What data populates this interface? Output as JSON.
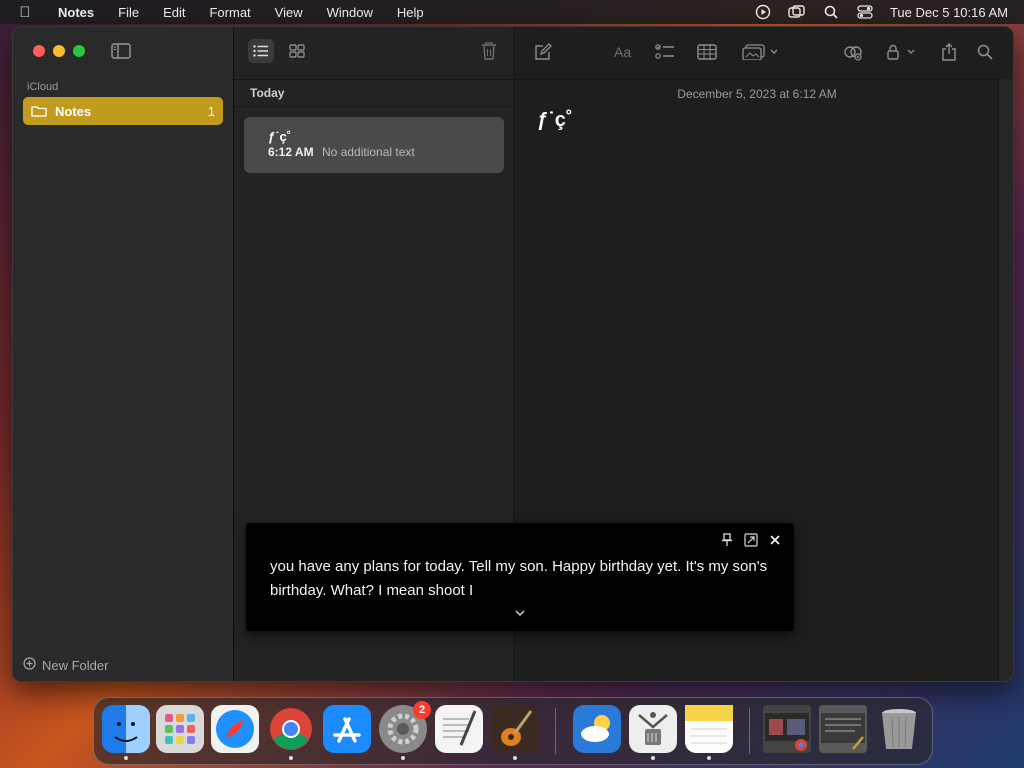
{
  "menubar": {
    "app": "Notes",
    "items": [
      "File",
      "Edit",
      "Format",
      "View",
      "Window",
      "Help"
    ],
    "clock": "Tue Dec 5  10:16 AM",
    "status_icons": [
      "screen-record-icon",
      "screen-mirror-icon",
      "spotlight-icon",
      "control-center-icon"
    ]
  },
  "sidebar": {
    "section": "iCloud",
    "folder": {
      "name": "Notes",
      "count": "1"
    },
    "new_folder": "New Folder"
  },
  "notelist": {
    "section": "Today",
    "note": {
      "title": "ƒ˙ç˚",
      "time": "6:12 AM",
      "preview": "No additional text"
    }
  },
  "editor": {
    "date": "December 5, 2023 at 6:12 AM",
    "title": "ƒ˙ç˚",
    "toolbar_icons": [
      "compose-icon",
      "format-icon",
      "checklist-icon",
      "table-icon",
      "media-icon",
      "collaborate-icon",
      "lock-icon",
      "share-icon",
      "search-icon"
    ]
  },
  "caption": {
    "text": "you have any plans for today. Tell my son. Happy birthday yet. It's my son's birthday. What? I mean shoot I"
  },
  "dock": {
    "apps": [
      {
        "name": "finder-icon",
        "color": "#2f8cf0"
      },
      {
        "name": "launchpad-icon",
        "color": "#d9d9d9"
      },
      {
        "name": "safari-icon",
        "color": "#1e90ff"
      },
      {
        "name": "chrome-icon",
        "color": "#e8e8e8"
      },
      {
        "name": "app-store-icon",
        "color": "#1a8cff"
      },
      {
        "name": "system-settings-icon",
        "color": "#8a8a8a",
        "badge": "2"
      },
      {
        "name": "textedit-icon",
        "color": "#f4f4f4"
      },
      {
        "name": "garageband-icon",
        "color": "#3a2a22"
      },
      {
        "name": "weather-icon",
        "color": "#2a7ad9"
      },
      {
        "name": "archive-utility-icon",
        "color": "#eeeeee"
      },
      {
        "name": "notes-icon",
        "color": "#f8d34a"
      },
      {
        "name": "recent-window-1-icon",
        "color": "#555555"
      },
      {
        "name": "recent-window-2-icon",
        "color": "#6a6a6a"
      },
      {
        "name": "trash-icon",
        "color": "#9a9a9a"
      }
    ]
  }
}
